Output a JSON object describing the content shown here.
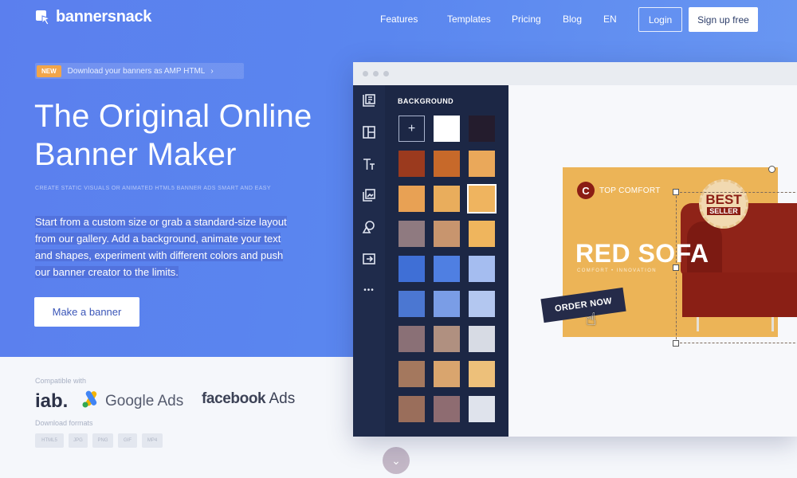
{
  "brand": {
    "name": "bannersnack"
  },
  "nav": {
    "items": [
      "Features",
      "Templates",
      "Pricing",
      "Blog",
      "EN"
    ],
    "login": "Login",
    "signup": "Sign up free"
  },
  "announcement": {
    "badge": "NEW",
    "text": "Download your banners as AMP HTML",
    "chevron": "›"
  },
  "hero": {
    "title_line1": "The Original Online",
    "title_line2": "Banner Maker",
    "tagline": "CREATE STATIC VISUALS OR ANIMATED HTML5 BANNER ADS SMART AND EASY",
    "description": "Start from a custom size or grab a standard-size layout from our gallery. Add a background, animate your text and shapes, experiment with different colors and push our banner creator to the limits.",
    "cta": "Make a banner"
  },
  "compat": {
    "label": "Compatible with",
    "brands": {
      "iab": "iab.",
      "google": "Google Ads",
      "facebook_bold": "facebook",
      "facebook_rest": " Ads"
    }
  },
  "download": {
    "label": "Download formats",
    "formats": [
      "HTML5",
      "JPG",
      "PNG",
      "GIF",
      "MP4"
    ]
  },
  "editor": {
    "panel_title": "BACKGROUND",
    "add_symbol": "+",
    "tools": [
      "layers-icon",
      "layout-icon",
      "text-icon",
      "media-icon",
      "shapes-icon",
      "export-icon",
      "more-icon"
    ],
    "more_symbol": "•••",
    "swatches": [
      [
        "add",
        "#ffffff",
        "#241c2d"
      ],
      [
        "#9b3a1e",
        "#c7692a",
        "#eaa85a"
      ],
      [
        "#e8a154",
        "#e9ad5c",
        "#efb45f"
      ],
      [
        "#8f7a80",
        "#c8956e",
        "#efb55d"
      ],
      [
        "#3f6fd6",
        "#4f7fe2",
        "#a5bdf0"
      ],
      [
        "#4b77d2",
        "#7a9de6",
        "#b3c7f0"
      ],
      [
        "#8a7076",
        "#b09080",
        "#d7dbe4"
      ],
      [
        "#a4785e",
        "#d9a56e",
        "#edc07a"
      ],
      [
        "#9a6e5b",
        "#8e6c71",
        "#dfe3ec"
      ]
    ]
  },
  "banner": {
    "logo_letter": "C",
    "brand": "TOP COMFORT",
    "title": "RED SOFA",
    "subtitle": "COMFORT • INNOVATION",
    "badge_line1": "BEST",
    "badge_line2": "SELLER",
    "cta": "ORDER NOW"
  },
  "colors": {
    "hero_bg": "#5b7fee",
    "accent_orange": "#f1a54a",
    "banner_bg": "#ecb457",
    "sofa": "#8f2318",
    "editor_dark": "#1c2745"
  }
}
